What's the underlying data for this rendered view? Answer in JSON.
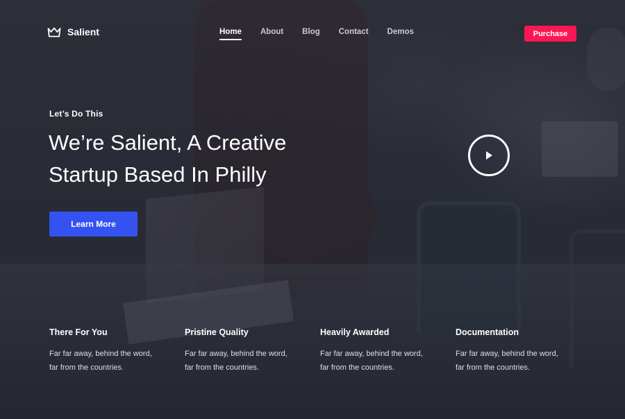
{
  "header": {
    "brand": "Salient",
    "nav": [
      {
        "label": "Home",
        "active": true
      },
      {
        "label": "About",
        "active": false
      },
      {
        "label": "Blog",
        "active": false
      },
      {
        "label": "Contact",
        "active": false
      },
      {
        "label": "Demos",
        "active": false
      }
    ],
    "purchase_label": "Purchase"
  },
  "hero": {
    "eyebrow": "Let’s Do This",
    "headline": "We’re Salient, A Creative Startup Based In Philly",
    "cta_label": "Learn More",
    "play_icon": "play-icon"
  },
  "features": [
    {
      "title": "There For You",
      "text": "Far far away, behind the word, far from the countries."
    },
    {
      "title": "Pristine Quality",
      "text": "Far far away, behind the word, far from the countries."
    },
    {
      "title": "Heavily Awarded",
      "text": "Far far away, behind the word, far from the countries."
    },
    {
      "title": "Documentation",
      "text": "Far far away, behind the word, far from the countries."
    }
  ],
  "colors": {
    "purchase": "#fb1755",
    "cta": "#3452f1"
  }
}
